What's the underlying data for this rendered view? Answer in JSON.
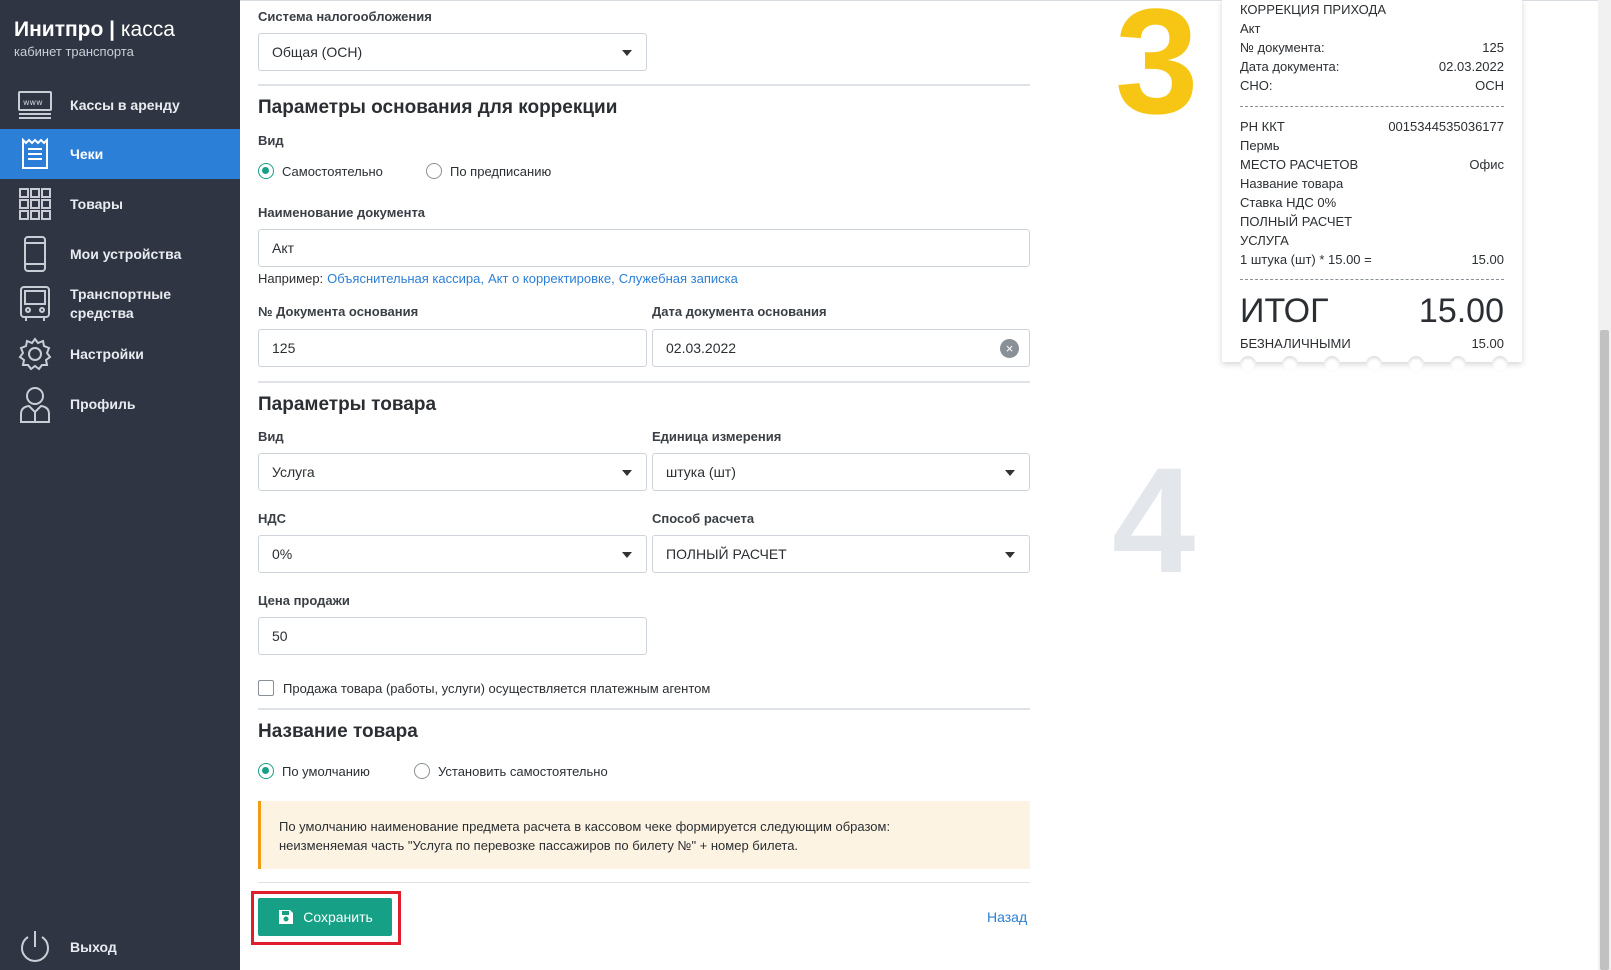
{
  "app": {
    "brand_bold": "Инитпро |",
    "brand_light": " касса",
    "subtitle": "кабинет транспорта"
  },
  "sidebar": {
    "items": [
      {
        "label": "Кассы в аренду",
        "icon": "www-icon"
      },
      {
        "label": "Чеки",
        "icon": "receipt-icon",
        "active": true
      },
      {
        "label": "Товары",
        "icon": "grid-icon"
      },
      {
        "label": "Мои устройства",
        "icon": "phone-icon"
      },
      {
        "label": "Транспортные средства",
        "icon": "bus-icon"
      },
      {
        "label": "Настройки",
        "icon": "gear-icon"
      },
      {
        "label": "Профиль",
        "icon": "user-icon"
      }
    ],
    "logout": {
      "label": "Выход",
      "icon": "power-icon"
    }
  },
  "form": {
    "tax": {
      "label": "Система налогообложения",
      "value": "Общая (ОСН)"
    },
    "correction": {
      "title": "Параметры основания для коррекции",
      "kind_label": "Вид",
      "kind_options": [
        "Самостоятельно",
        "По предписанию"
      ],
      "doc_name_label": "Наименование документа",
      "doc_name_value": "Акт",
      "example_prefix": "Например:",
      "examples": [
        "Объяснительная кассира,",
        "Акт о корректировке,",
        "Служебная записка"
      ],
      "doc_no_label": "№ Документа основания",
      "doc_no_value": "125",
      "doc_date_label": "Дата документа основания",
      "doc_date_value": "02.03.2022",
      "clear_glyph": "×"
    },
    "product": {
      "title": "Параметры товара",
      "kind_label": "Вид",
      "kind_value": "Услуга",
      "unit_label": "Единица измерения",
      "unit_value": "штука (шт)",
      "vat_label": "НДС",
      "vat_value": "0%",
      "payment_label": "Способ расчета",
      "payment_value": "ПОЛНЫЙ РАСЧЕТ",
      "price_label": "Цена продажи",
      "price_value": "50",
      "agent_label": "Продажа товара (работы, услуги) осуществляется платежным агентом"
    },
    "name": {
      "title": "Название товара",
      "options": [
        "По умолчанию",
        "Установить самостоятельно"
      ],
      "notice_line1": "По умолчанию наименование предмета расчета в кассовом чеке формируется следующим образом:",
      "notice_line2": "неизменяемая часть \"Услуга по перевозке пассажиров по билету №\" + номер билета."
    },
    "save_label": "Сохранить",
    "back_label": "Назад"
  },
  "steps": {
    "three": "3",
    "four": "4"
  },
  "colors": {
    "step3": "#f7c614",
    "step4": "#e3e6ea",
    "accent": "#16a085",
    "sidebar_active": "#2c7fd6"
  },
  "receipt": {
    "title": "КОРРЕКЦИЯ ПРИХОДА",
    "doc": "Акт",
    "rows1": [
      {
        "k": "№ документа:",
        "v": "125"
      },
      {
        "k": "Дата документа:",
        "v": "02.03.2022"
      },
      {
        "k": "СНО:",
        "v": "ОСН"
      }
    ],
    "rn_label": "РН ККТ",
    "rn_value": "0015344535036177",
    "city": "Пермь",
    "place_label": "МЕСТО РАСЧЕТОВ",
    "place_value": "Офис",
    "item_name": "Название товара",
    "vat": "Ставка НДС 0%",
    "calc": "ПОЛНЫЙ РАСЧЕТ",
    "subject": "УСЛУГА",
    "qty_label": "1 штука (шт) * 15.00 =",
    "qty_value": "15.00",
    "total_label": "ИТОГ",
    "total_value": "15.00",
    "cashless_label": "БЕЗНАЛИЧНЫМИ",
    "cashless_value": "15.00"
  }
}
